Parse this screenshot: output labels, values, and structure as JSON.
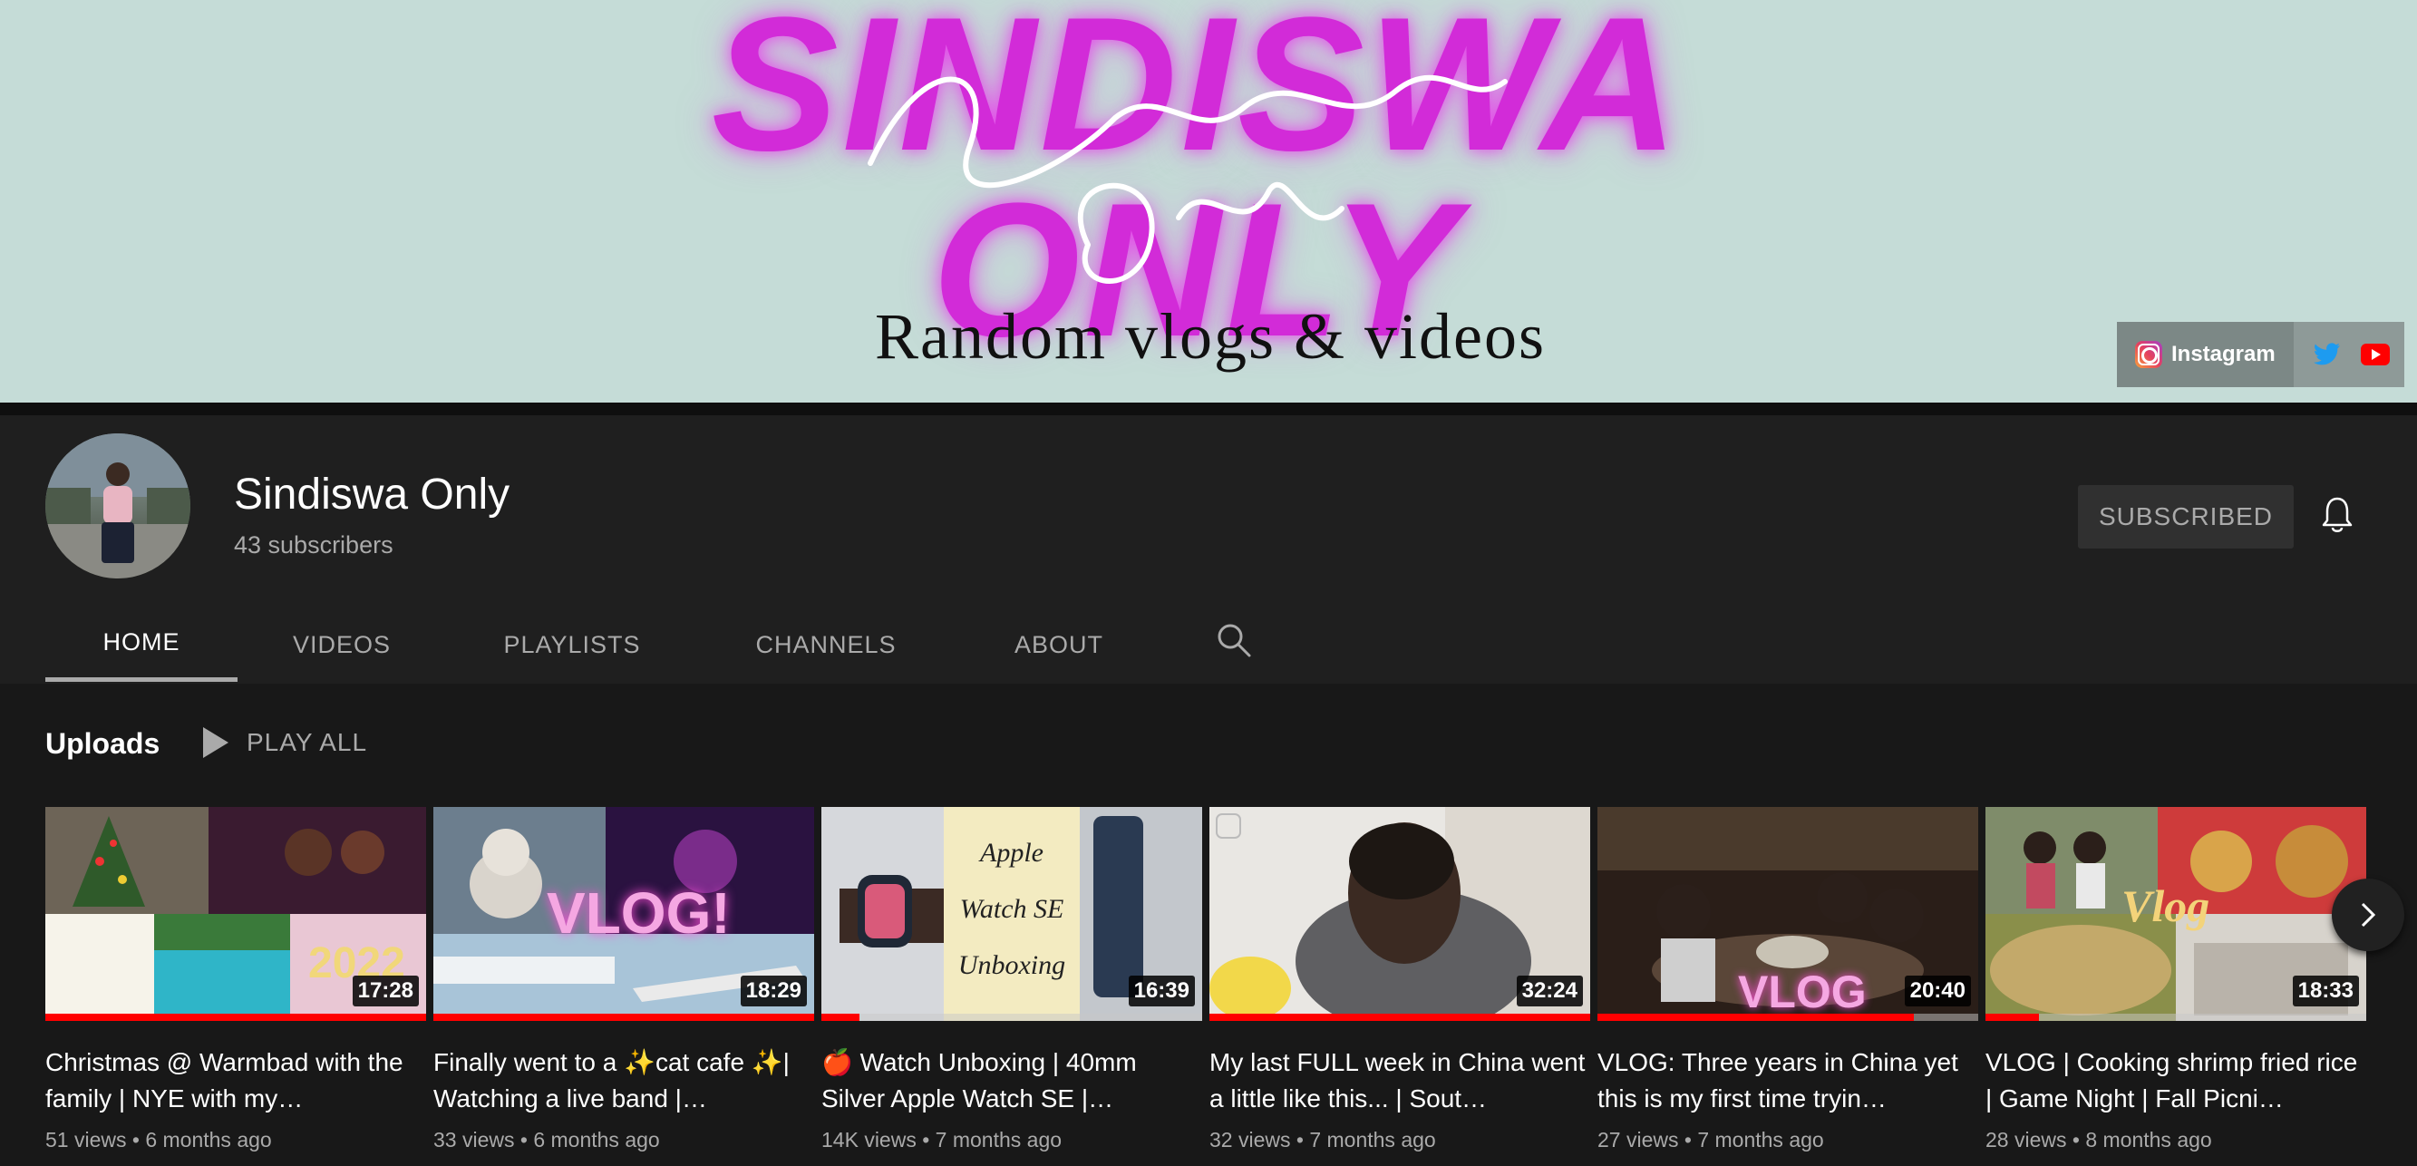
{
  "banner": {
    "title_line1": "SINDISWA",
    "title_line2": "ONLY",
    "tagline": "Random vlogs & videos",
    "links": {
      "instagram_label": "Instagram"
    }
  },
  "channel": {
    "name": "Sindiswa Only",
    "subscribers": "43 subscribers",
    "subscribe_label": "SUBSCRIBED"
  },
  "tabs": [
    {
      "label": "HOME",
      "active": true
    },
    {
      "label": "VIDEOS"
    },
    {
      "label": "PLAYLISTS"
    },
    {
      "label": "CHANNELS"
    },
    {
      "label": "ABOUT"
    }
  ],
  "shelf": {
    "title": "Uploads",
    "play_all": "PLAY ALL"
  },
  "videos": [
    {
      "title": "Christmas @ Warmbad with the family | NYE with my…",
      "duration": "17:28",
      "views": "51 views",
      "age": "6 months ago",
      "watched_fraction": 1.0,
      "overlay_text": "2022"
    },
    {
      "title": "Finally went to a ✨cat cafe ✨| Watching a live band |…",
      "duration": "18:29",
      "views": "33 views",
      "age": "6 months ago",
      "watched_fraction": 1.0,
      "overlay_text": "VLOG!"
    },
    {
      "title": "🍎 Watch Unboxing | 40mm Silver Apple Watch SE |…",
      "duration": "16:39",
      "views": "14K views",
      "age": "7 months ago",
      "watched_fraction": 0.1,
      "overlay_text": "Apple Watch SE Unboxing"
    },
    {
      "title": "My last FULL week in China went a little like this... | Sout…",
      "duration": "32:24",
      "views": "32 views",
      "age": "7 months ago",
      "watched_fraction": 1.0,
      "overlay_text": ""
    },
    {
      "title": "VLOG: Three years in China yet this is my first time tryin…",
      "duration": "20:40",
      "views": "27 views",
      "age": "7 months ago",
      "watched_fraction": 0.83,
      "overlay_text": "VLOG"
    },
    {
      "title": "VLOG | Cooking shrimp fried rice | Game Night | Fall Picni…",
      "duration": "18:33",
      "views": "28 views",
      "age": "8 months ago",
      "watched_fraction": 0.14,
      "overlay_text": "Vlog"
    }
  ],
  "icons": {
    "search": "search-icon",
    "bell": "bell-icon",
    "play": "play-icon",
    "next": "chevron-right-icon",
    "instagram": "instagram-icon",
    "twitter": "twitter-icon",
    "youtube": "youtube-icon"
  },
  "colors": {
    "banner_bg": "#c5dcd7",
    "banner_title": "#d22bd8",
    "page_bg": "#181818",
    "header_bg": "#1f1f1f",
    "progress": "#ff0000"
  }
}
